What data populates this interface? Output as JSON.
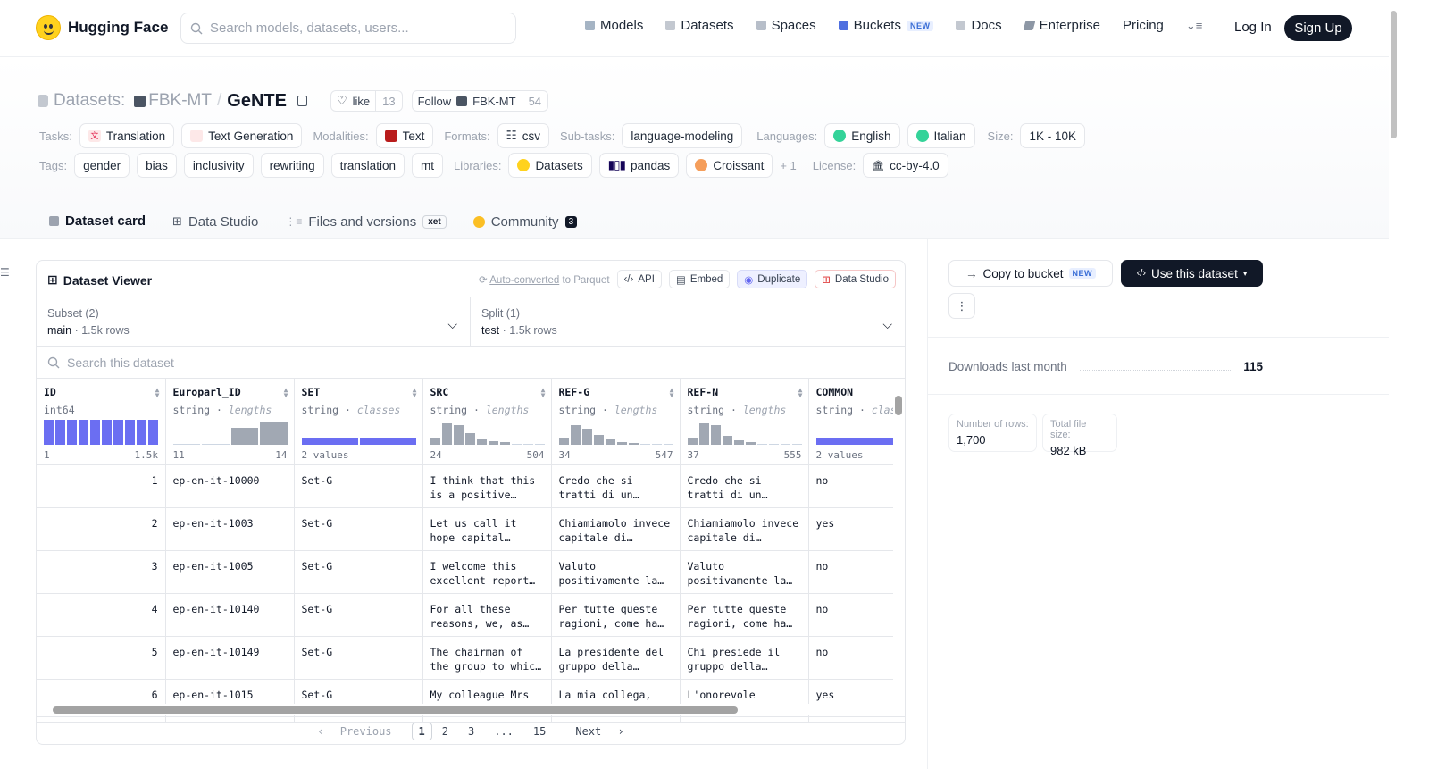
{
  "nav": {
    "brand": "Hugging Face",
    "search_placeholder": "Search models, datasets, users...",
    "links": [
      "Models",
      "Datasets",
      "Spaces",
      "Buckets",
      "Docs",
      "Enterprise",
      "Pricing"
    ],
    "buckets_badge": "NEW",
    "login": "Log In",
    "signup": "Sign Up"
  },
  "header": {
    "prefix": "Datasets:",
    "org": "FBK-MT",
    "sep": "/",
    "name": "GeNTE",
    "like_label": "like",
    "like_count": "13",
    "follow_label": "Follow",
    "follow_org": "FBK-MT",
    "follow_count": "54"
  },
  "meta": {
    "tasks_label": "Tasks:",
    "tasks": [
      "Translation",
      "Text Generation"
    ],
    "modalities_label": "Modalities:",
    "modalities": [
      "Text"
    ],
    "formats_label": "Formats:",
    "formats": [
      "csv"
    ],
    "subtasks_label": "Sub-tasks:",
    "subtasks": [
      "language-modeling"
    ],
    "languages_label": "Languages:",
    "languages": [
      "English",
      "Italian"
    ],
    "size_label": "Size:",
    "size": "1K - 10K",
    "tags_label": "Tags:",
    "tags": [
      "gender",
      "bias",
      "inclusivity",
      "rewriting",
      "translation",
      "mt"
    ],
    "libraries_label": "Libraries:",
    "libraries": [
      "Datasets",
      "pandas",
      "Croissant"
    ],
    "libraries_more": "+ 1",
    "license_label": "License:",
    "license": "cc-by-4.0"
  },
  "tabs": [
    {
      "label": "Dataset card"
    },
    {
      "label": "Data Studio"
    },
    {
      "label": "Files and versions",
      "badge": "xet"
    },
    {
      "label": "Community",
      "badge": "3"
    }
  ],
  "viewer": {
    "title": "Dataset Viewer",
    "auto_converted": "Auto-converted",
    "to_parquet": "to Parquet",
    "api": "API",
    "embed": "Embed",
    "duplicate": "Duplicate",
    "data_studio": "Data Studio",
    "subset_label": "Subset (2)",
    "subset_value": "main",
    "subset_rows": "1.5k rows",
    "split_label": "Split (1)",
    "split_value": "test",
    "split_rows": "1.5k rows",
    "search_placeholder": "Search this dataset",
    "columns": [
      {
        "name": "ID",
        "type": "int64",
        "kind": "",
        "min": "1",
        "max": "1.5k"
      },
      {
        "name": "Europarl_ID",
        "type": "string",
        "kind": "lengths",
        "min": "11",
        "max": "14"
      },
      {
        "name": "SET",
        "type": "string",
        "kind": "classes",
        "min": "2 values",
        "max": ""
      },
      {
        "name": "SRC",
        "type": "string",
        "kind": "lengths",
        "min": "24",
        "max": "504"
      },
      {
        "name": "REF-G",
        "type": "string",
        "kind": "lengths",
        "min": "34",
        "max": "547"
      },
      {
        "name": "REF-N",
        "type": "string",
        "kind": "lengths",
        "min": "37",
        "max": "555"
      },
      {
        "name": "COMMON",
        "type": "string",
        "kind": "clas",
        "min": "2 values",
        "max": ""
      }
    ],
    "rows": [
      [
        "1",
        "ep-en-it-10000",
        "Set-G",
        "I think that this is a positive…",
        "Credo che si tratti di un…",
        "Credo che si tratti di un…",
        "no"
      ],
      [
        "2",
        "ep-en-it-1003",
        "Set-G",
        "Let us call it hope capital…",
        "Chiamiamolo invece capitale di…",
        "Chiamiamolo invece capitale di…",
        "yes"
      ],
      [
        "3",
        "ep-en-it-1005",
        "Set-G",
        "I welcome this excellent report…",
        "Valuto positivamente la…",
        "Valuto positivamente la…",
        "no"
      ],
      [
        "4",
        "ep-en-it-10140",
        "Set-G",
        "For all these reasons, we, as…",
        "Per tutte queste ragioni, come ha…",
        "Per tutte queste ragioni, come ha…",
        "no"
      ],
      [
        "5",
        "ep-en-it-10149",
        "Set-G",
        "The chairman of the group to whic…",
        "La presidente del gruppo della…",
        "Chi presiede il gruppo della…",
        "no"
      ],
      [
        "6",
        "ep-en-it-1015",
        "Set-G",
        "My colleague Mrs",
        "La mia collega,",
        "L'onorevole",
        "yes"
      ]
    ],
    "pager": {
      "prev": "Previous",
      "pages": [
        "1",
        "2",
        "3",
        "...",
        "15"
      ],
      "next": "Next"
    }
  },
  "sidebar": {
    "copy_bucket": "Copy to bucket",
    "copy_badge": "NEW",
    "use_dataset": "Use this dataset",
    "downloads_label": "Downloads last month",
    "downloads_value": "115",
    "rows_label": "Number of rows:",
    "rows_value": "1,700",
    "size_label": "Total file size:",
    "size_value": "982 kB"
  }
}
